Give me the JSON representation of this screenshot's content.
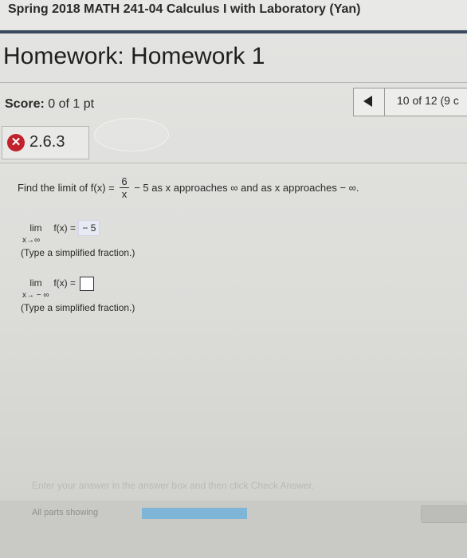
{
  "course": {
    "title": "Spring 2018 MATH 241-04 Calculus I with Laboratory (Yan)"
  },
  "homework": {
    "title": "Homework: Homework 1"
  },
  "score": {
    "label": "Score:",
    "value": "0 of 1 pt"
  },
  "navigation": {
    "position": "10 of 12 (9 c"
  },
  "question": {
    "status": "incorrect",
    "number": "2.6.3",
    "prompt_start": "Find the limit of f(x) =",
    "fraction_numerator": "6",
    "fraction_denominator": "x",
    "prompt_end": "− 5 as x approaches ∞ and as x approaches − ∞."
  },
  "parts": [
    {
      "lim_word": "lim",
      "function": "f(x) =",
      "subscript": "x→∞",
      "answer": "− 5",
      "hint": "(Type a simplified fraction.)"
    },
    {
      "lim_word": "lim",
      "function": "f(x) =",
      "subscript": "x→ − ∞",
      "answer": "",
      "hint": "(Type a simplified fraction.)"
    }
  ],
  "footer": {
    "instruction": "Enter your answer in the answer box and then click Check Answer.",
    "parts_label": "All parts showing",
    "progress": 1.0
  },
  "colors": {
    "header_rule": "#3a4a5e",
    "wrong_icon": "#c0212b",
    "progress_fill": "#7fb6d8"
  },
  "icons": {
    "status": "incorrect-x-icon",
    "previous": "triangle-left-icon"
  }
}
